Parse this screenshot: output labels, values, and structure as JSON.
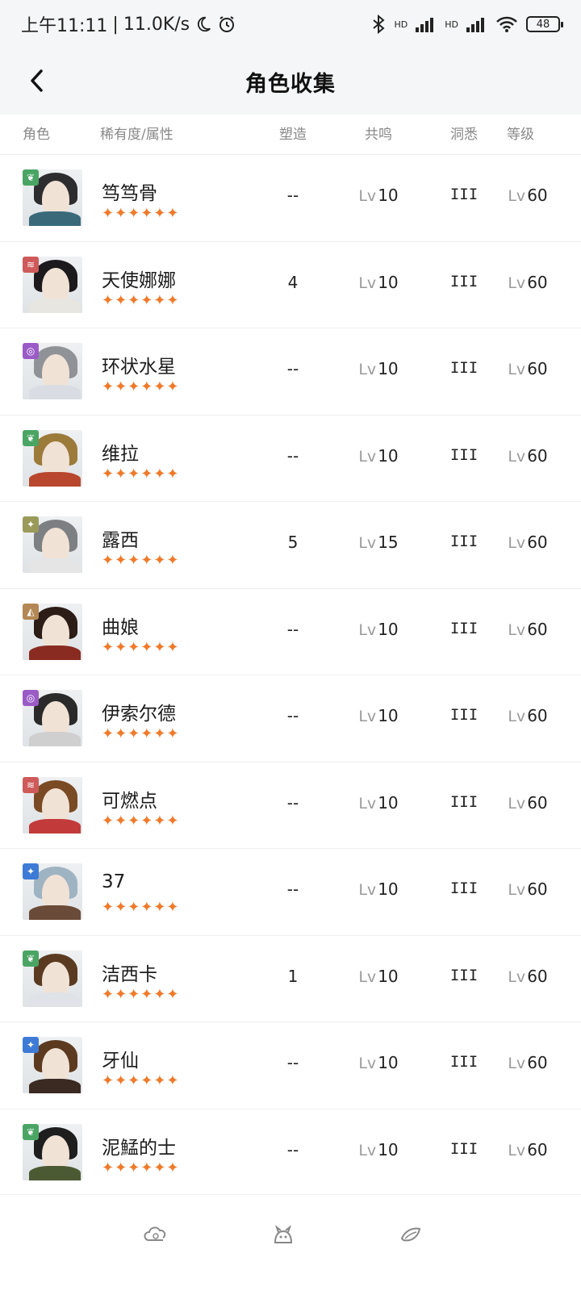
{
  "status": {
    "time": "上午11:11",
    "network": "11.0K/s",
    "battery": "48",
    "hd": "HD"
  },
  "header": {
    "title": "角色收集"
  },
  "columns": {
    "role": "角色",
    "rarity": "稀有度/属性",
    "shape": "塑造",
    "reson": "共鸣",
    "insight": "洞悉",
    "level": "等级"
  },
  "rows": [
    {
      "name": "笃笃骨",
      "stars": "✦✦✦✦✦✦",
      "shape": "--",
      "reson_prefix": "Lv",
      "reson": "10",
      "insight": "III",
      "level_prefix": "Lv",
      "level": "60",
      "attr": "plant",
      "attr_color": "#4aa564",
      "hair": "#2d2d2f",
      "cloth": "#3a6a7a"
    },
    {
      "name": "天使娜娜",
      "stars": "✦✦✦✦✦✦",
      "shape": "4",
      "reson_prefix": "Lv",
      "reson": "10",
      "insight": "III",
      "level_prefix": "Lv",
      "level": "60",
      "attr": "beast",
      "attr_color": "#cf5a5a",
      "hair": "#1c1a1c",
      "cloth": "#e8e6e0"
    },
    {
      "name": "环状水星",
      "stars": "✦✦✦✦✦✦",
      "shape": "--",
      "reson_prefix": "Lv",
      "reson": "10",
      "insight": "III",
      "level_prefix": "Lv",
      "level": "60",
      "attr": "spirit",
      "attr_color": "#9b5bc7",
      "hair": "#8f9297",
      "cloth": "#d9dde3"
    },
    {
      "name": "维拉",
      "stars": "✦✦✦✦✦✦",
      "shape": "--",
      "reson_prefix": "Lv",
      "reson": "10",
      "insight": "III",
      "level_prefix": "Lv",
      "level": "60",
      "attr": "plant",
      "attr_color": "#4aa564",
      "hair": "#9c7a3a",
      "cloth": "#b8472d"
    },
    {
      "name": "露西",
      "stars": "✦✦✦✦✦✦",
      "shape": "5",
      "reson_prefix": "Lv",
      "reson": "15",
      "insight": "III",
      "level_prefix": "Lv",
      "level": "60",
      "attr": "star",
      "attr_color": "#9a9a5a",
      "hair": "#7d8082",
      "cloth": "#e5e5e5"
    },
    {
      "name": "曲娘",
      "stars": "✦✦✦✦✦✦",
      "shape": "--",
      "reson_prefix": "Lv",
      "reson": "10",
      "insight": "III",
      "level_prefix": "Lv",
      "level": "60",
      "attr": "intellect",
      "attr_color": "#b38854",
      "hair": "#2c1d17",
      "cloth": "#8a2b22"
    },
    {
      "name": "伊索尔德",
      "stars": "✦✦✦✦✦✦",
      "shape": "--",
      "reson_prefix": "Lv",
      "reson": "10",
      "insight": "III",
      "level_prefix": "Lv",
      "level": "60",
      "attr": "spirit",
      "attr_color": "#9b5bc7",
      "hair": "#2a2a2a",
      "cloth": "#cfcfcf"
    },
    {
      "name": "可燃点",
      "stars": "✦✦✦✦✦✦",
      "shape": "--",
      "reson_prefix": "Lv",
      "reson": "10",
      "insight": "III",
      "level_prefix": "Lv",
      "level": "60",
      "attr": "beast",
      "attr_color": "#cf5a5a",
      "hair": "#7a4a24",
      "cloth": "#c23a3a"
    },
    {
      "name": "37",
      "stars": "✦✦✦✦✦✦",
      "shape": "--",
      "reson_prefix": "Lv",
      "reson": "10",
      "insight": "III",
      "level_prefix": "Lv",
      "level": "60",
      "attr": "star",
      "attr_color": "#3e7bd6",
      "hair": "#9fb4c2",
      "cloth": "#6a4a38"
    },
    {
      "name": "洁西卡",
      "stars": "✦✦✦✦✦✦",
      "shape": "1",
      "reson_prefix": "Lv",
      "reson": "10",
      "insight": "III",
      "level_prefix": "Lv",
      "level": "60",
      "attr": "plant",
      "attr_color": "#4aa564",
      "hair": "#5a3b22",
      "cloth": "#dfe2e6"
    },
    {
      "name": "牙仙",
      "stars": "✦✦✦✦✦✦",
      "shape": "--",
      "reson_prefix": "Lv",
      "reson": "10",
      "insight": "III",
      "level_prefix": "Lv",
      "level": "60",
      "attr": "star",
      "attr_color": "#3e7bd6",
      "hair": "#5c3a20",
      "cloth": "#3a2a22"
    },
    {
      "name": "泥鯭的士",
      "stars": "✦✦✦✦✦✦",
      "shape": "--",
      "reson_prefix": "Lv",
      "reson": "10",
      "insight": "III",
      "level_prefix": "Lv",
      "level": "60",
      "attr": "plant",
      "attr_color": "#4aa564",
      "hair": "#1e1e1e",
      "cloth": "#4c5a33"
    }
  ],
  "bottom_nav": [
    {
      "icon": "cloud-icon"
    },
    {
      "icon": "creature-icon"
    },
    {
      "icon": "leaf-icon"
    }
  ]
}
